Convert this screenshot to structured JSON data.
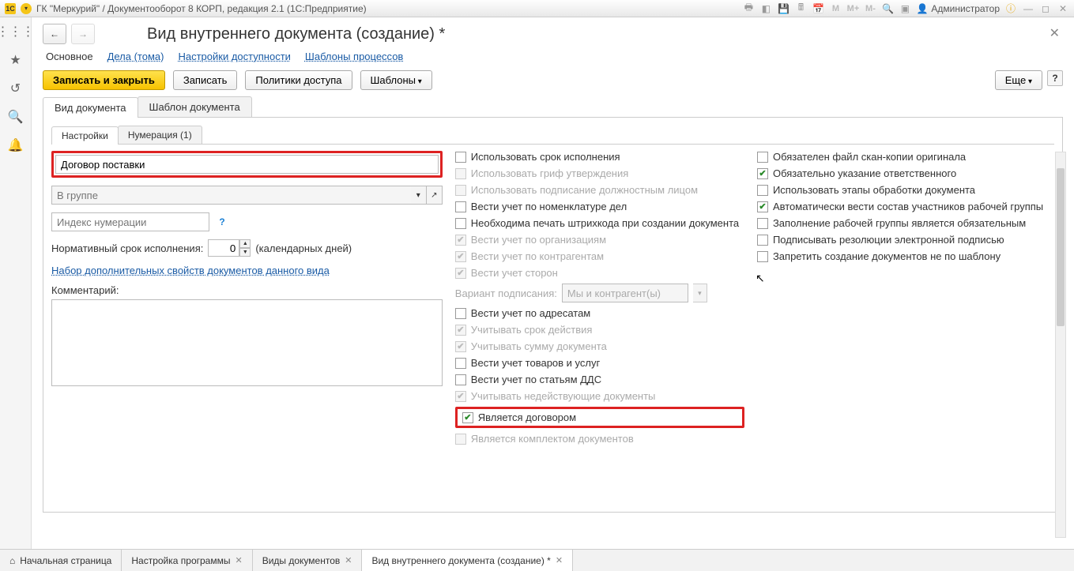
{
  "titlebar": {
    "app_title": "ГК \"Меркурий\" / Документооборот 8 КОРП, редакция 2.1  (1С:Предприятие)",
    "user_label": "Администратор",
    "m_buttons": [
      "М",
      "М+",
      "М-"
    ]
  },
  "nav": {
    "back": "←",
    "forward": "→"
  },
  "page_title": "Вид внутреннего документа (создание) *",
  "nav_tabs": [
    "Основное",
    "Дела (тома)",
    "Настройки доступности",
    "Шаблоны процессов"
  ],
  "nav_tabs_active": 0,
  "toolbar": {
    "save_close": "Записать и закрыть",
    "save": "Записать",
    "policies": "Политики доступа",
    "templates": "Шаблоны",
    "more": "Еще",
    "help": "?"
  },
  "tabs2": [
    "Вид документа",
    "Шаблон документа"
  ],
  "tabs2_active": 0,
  "tabs3": [
    "Настройки",
    "Нумерация (1)"
  ],
  "tabs3_active": 0,
  "fields": {
    "name_value": "Договор поставки",
    "group_placeholder": "В группе",
    "index_placeholder": "Индекс нумерации",
    "deadline_label": "Нормативный срок исполнения:",
    "deadline_value": "0",
    "deadline_unit": "(календарных дней)",
    "extra_props_link": "Набор дополнительных свойств документов данного вида",
    "comment_label": "Комментарий:"
  },
  "checks_mid": [
    {
      "label": "Использовать срок исполнения",
      "checked": false,
      "disabled": false
    },
    {
      "label": "Использовать гриф утверждения",
      "checked": false,
      "disabled": true
    },
    {
      "label": "Использовать подписание должностным лицом",
      "checked": false,
      "disabled": true
    },
    {
      "label": "Вести учет по номенклатуре дел",
      "checked": false,
      "disabled": false
    },
    {
      "label": "Необходима печать штрихкода при создании документа",
      "checked": false,
      "disabled": false
    },
    {
      "label": "Вести учет по организациям",
      "checked": true,
      "disabled": true
    },
    {
      "label": "Вести учет по контрагентам",
      "checked": true,
      "disabled": true
    },
    {
      "label": "Вести учет сторон",
      "checked": true,
      "disabled": true
    }
  ],
  "sign_variant": {
    "label": "Вариант подписания:",
    "value": "Мы и контрагент(ы)",
    "disabled": true
  },
  "checks_mid2": [
    {
      "label": "Вести учет по адресатам",
      "checked": false,
      "disabled": false
    },
    {
      "label": "Учитывать срок действия",
      "checked": true,
      "disabled": true
    },
    {
      "label": "Учитывать сумму документа",
      "checked": true,
      "disabled": true
    },
    {
      "label": "Вести учет товаров и услуг",
      "checked": false,
      "disabled": false
    },
    {
      "label": "Вести учет по статьям ДДС",
      "checked": false,
      "disabled": false
    },
    {
      "label": "Учитывать недействующие документы",
      "checked": true,
      "disabled": true
    },
    {
      "label": "Является договором",
      "checked": true,
      "disabled": false,
      "highlight": true
    },
    {
      "label": "Является комплектом документов",
      "checked": false,
      "disabled": true
    }
  ],
  "checks_right": [
    {
      "label": "Обязателен файл скан-копии оригинала",
      "checked": false,
      "disabled": false
    },
    {
      "label": "Обязательно указание ответственного",
      "checked": true,
      "disabled": false
    },
    {
      "label": "Использовать этапы обработки документа",
      "checked": false,
      "disabled": false
    },
    {
      "label": "Автоматически вести состав участников рабочей группы",
      "checked": true,
      "disabled": false
    },
    {
      "label": "Заполнение рабочей группы является обязательным",
      "checked": false,
      "disabled": false
    },
    {
      "label": "Подписывать резолюции электронной подписью",
      "checked": false,
      "disabled": false
    },
    {
      "label": "Запретить создание документов не по шаблону",
      "checked": false,
      "disabled": false
    }
  ],
  "bottom_tabs": [
    {
      "label": "Начальная страница",
      "closable": false,
      "icon": "home"
    },
    {
      "label": "Настройка программы",
      "closable": true
    },
    {
      "label": "Виды документов",
      "closable": true
    },
    {
      "label": "Вид внутреннего документа (создание) *",
      "closable": true,
      "active": true
    }
  ]
}
